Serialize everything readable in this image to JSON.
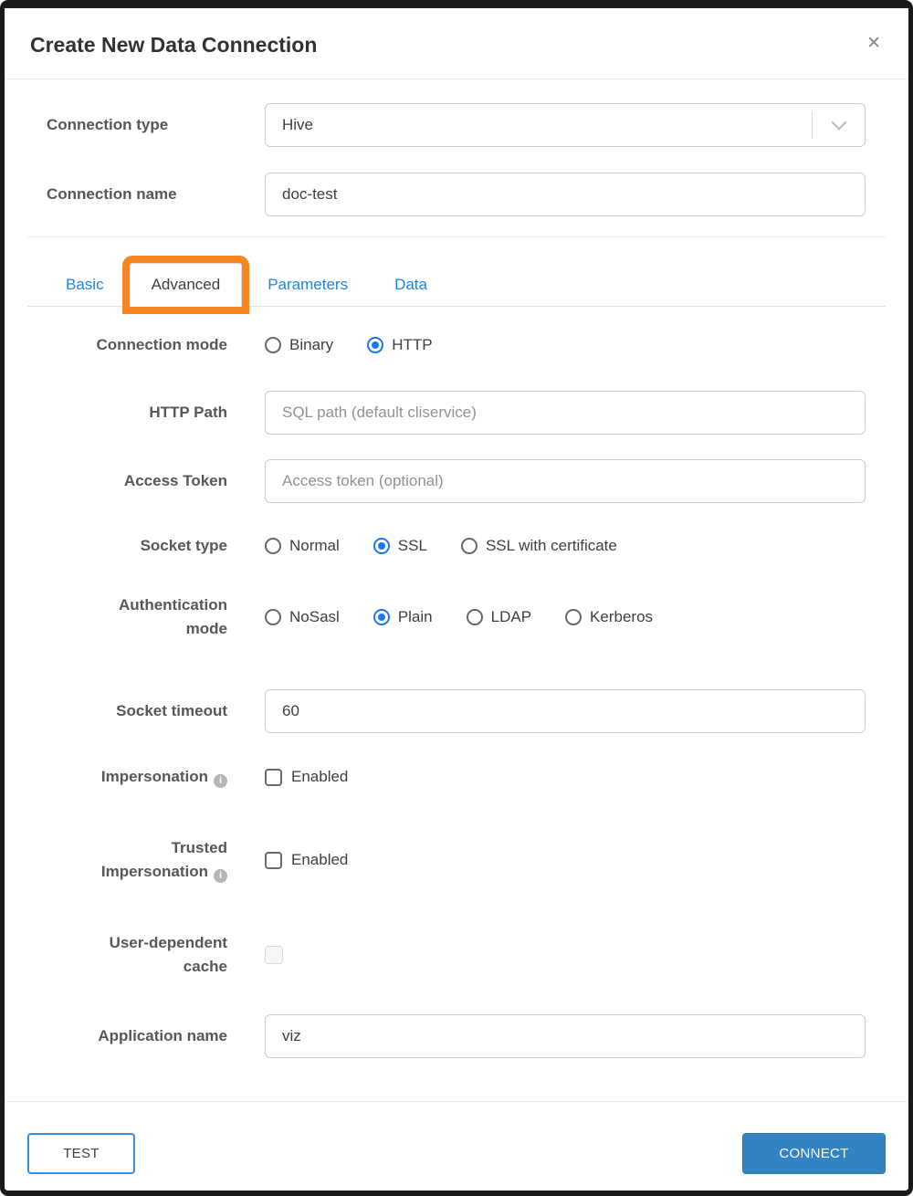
{
  "modal": {
    "title": "Create New Data Connection",
    "close_icon": "✕"
  },
  "top_fields": {
    "connection_type": {
      "label": "Connection type",
      "value": "Hive"
    },
    "connection_name": {
      "label": "Connection name",
      "value": "doc-test"
    }
  },
  "tabs": {
    "items": [
      {
        "label": "Basic"
      },
      {
        "label": "Advanced"
      },
      {
        "label": "Parameters"
      },
      {
        "label": "Data"
      }
    ],
    "active": "Advanced",
    "highlight_color": "#f6861f"
  },
  "form": {
    "connection_mode": {
      "label": "Connection mode",
      "options": [
        "Binary",
        "HTTP"
      ],
      "selected": "HTTP"
    },
    "http_path": {
      "label": "HTTP Path",
      "value": "",
      "placeholder": "SQL path (default cliservice)"
    },
    "access_token": {
      "label": "Access Token",
      "value": "",
      "placeholder": "Access token (optional)"
    },
    "socket_type": {
      "label": "Socket type",
      "options": [
        "Normal",
        "SSL",
        "SSL with certificate"
      ],
      "selected": "SSL"
    },
    "authentication_mode": {
      "label": "Authentication mode",
      "options": [
        "NoSasl",
        "Plain",
        "LDAP",
        "Kerberos"
      ],
      "selected": "Plain"
    },
    "socket_timeout": {
      "label": "Socket timeout",
      "value": "60"
    },
    "impersonation": {
      "label": "Impersonation",
      "info_icon": "i",
      "checkbox_label": "Enabled",
      "checked": false
    },
    "trusted_impersonation": {
      "label": "Trusted Impersonation",
      "info_icon": "i",
      "checkbox_label": "Enabled",
      "checked": false
    },
    "user_dependent_cache": {
      "label": "User-dependent cache",
      "checked": false,
      "disabled": true
    },
    "application_name": {
      "label": "Application name",
      "value": "viz"
    }
  },
  "footer": {
    "test_label": "TEST",
    "connect_label": "CONNECT"
  },
  "colors": {
    "tab_link_blue": "#1d86dd",
    "radio_blue": "#1d76f2",
    "connect_button_blue": "#3383c4",
    "test_border_blue": "#3a8fd9",
    "highlight_orange": "#f6861f",
    "frame_border": "#1a1a1a"
  }
}
